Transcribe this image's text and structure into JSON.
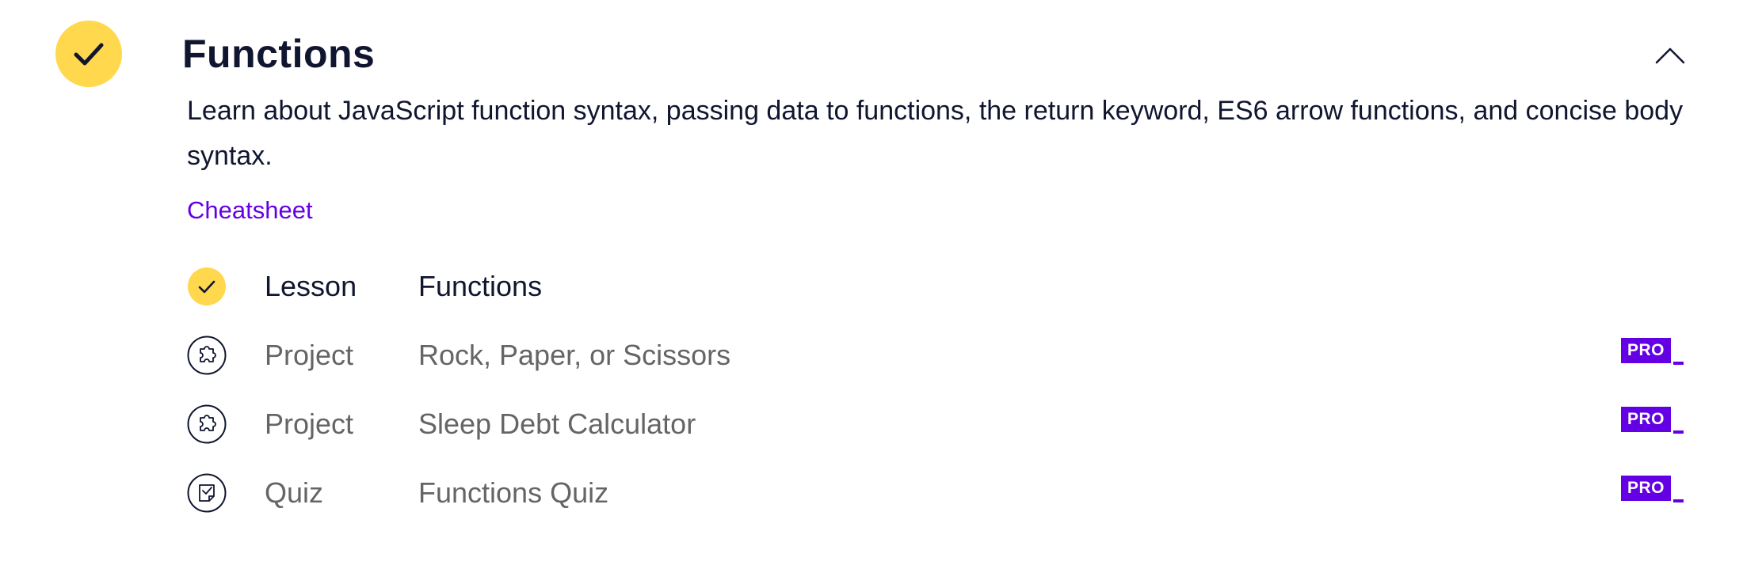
{
  "module": {
    "title": "Functions",
    "description": "Learn about JavaScript function syntax, passing data to functions, the return keyword, ES6 arrow functions, and concise body syntax.",
    "cheatsheet_label": "Cheatsheet",
    "status": "completed",
    "status_icon": "check-icon",
    "collapse_icon": "chevron-up-icon"
  },
  "items": [
    {
      "type": "Lesson",
      "name": "Functions",
      "icon": "check-icon",
      "completed": true,
      "pro": false
    },
    {
      "type": "Project",
      "name": "Rock, Paper, or Scissors",
      "icon": "puzzle-icon",
      "completed": false,
      "pro": true
    },
    {
      "type": "Project",
      "name": "Sleep Debt Calculator",
      "icon": "puzzle-icon",
      "completed": false,
      "pro": true
    },
    {
      "type": "Quiz",
      "name": "Functions Quiz",
      "icon": "quiz-icon",
      "completed": false,
      "pro": true
    }
  ],
  "pro_badge_label": "PRO",
  "colors": {
    "completed_yellow": "#ffd84d",
    "navy_text": "#10162f",
    "muted_text": "#656565",
    "accent_purple": "#6400e4"
  }
}
